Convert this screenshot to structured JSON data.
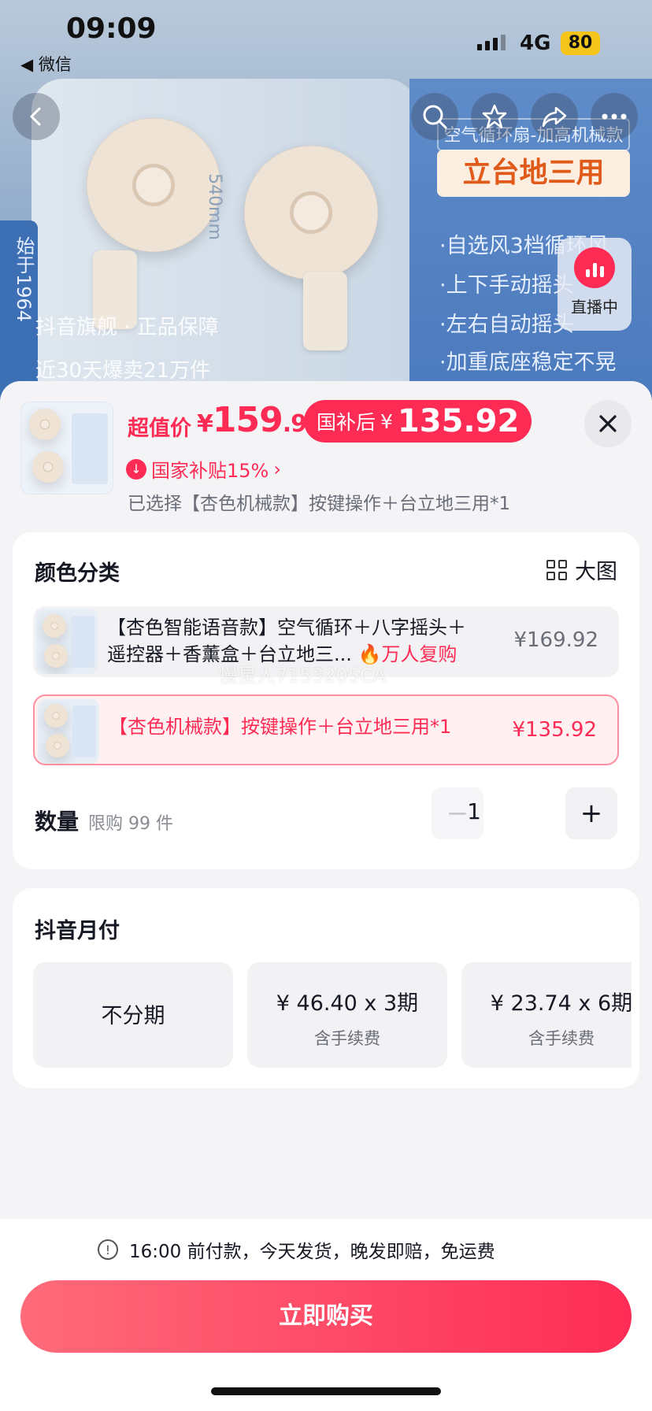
{
  "status_bar": {
    "time": "09:09",
    "back_app": "◀ 微信",
    "network": "4G",
    "battery": "80"
  },
  "background": {
    "tag_top": "空气循环扇-加高机械款",
    "tag_main": "立台地三用",
    "features": [
      "·自选风3档循环风",
      "·上下手动摇头",
      "·左右自动摇头",
      "·加重底座稳定不晃"
    ],
    "vertical_text": "始于1964",
    "note1": "抖音旗舰 · 正品保障",
    "note2": "近30天爆卖21万件",
    "dimension": "540mm"
  },
  "nav": {
    "icons": [
      "back-icon",
      "search-icon",
      "star-icon",
      "share-icon",
      "more-icon"
    ],
    "live_label": "直播中"
  },
  "product": {
    "price_label": "超值价",
    "price_symbol": "¥",
    "price_int": "159",
    "price_dec": ".9",
    "subsidy_label": "国补后",
    "subsidy_symbol": "¥",
    "subsidy_price": "135.92",
    "gov_subsidy": "国家补贴15%",
    "selected": "已选择【杏色机械款】按键操作＋台立地三用*1"
  },
  "variants": {
    "title": "颜色分类",
    "big_image_label": "大图",
    "options": [
      {
        "line1": "【杏色智能语音款】空气循环＋八字摇头＋",
        "line2": "遥控器＋香薰盒＋台立地三...",
        "hot": "万人复购",
        "price": "¥169.92",
        "selected": false
      },
      {
        "line1": "【杏色机械款】按键操作＋台立地三用*1",
        "price": "¥135.92",
        "selected": true
      }
    ],
    "watermark": "慢星人7153205CA"
  },
  "quantity": {
    "label": "数量",
    "limit": "限购 99 件",
    "minus": "−",
    "value": "1",
    "plus": "+"
  },
  "payment": {
    "title": "抖音月付",
    "plans": [
      {
        "amount": "不分期",
        "fee": ""
      },
      {
        "amount": "¥ 46.40 x 3期",
        "fee": "含手续费"
      },
      {
        "amount": "¥ 23.74 x 6期",
        "fee": "含手续费"
      }
    ]
  },
  "footer": {
    "notice": "16:00 前付款，今天发货，晚发即赔，免运费",
    "buy_label": "立即购买"
  },
  "colors": {
    "accent": "#fe2c55",
    "background": "#f4f4f6"
  }
}
